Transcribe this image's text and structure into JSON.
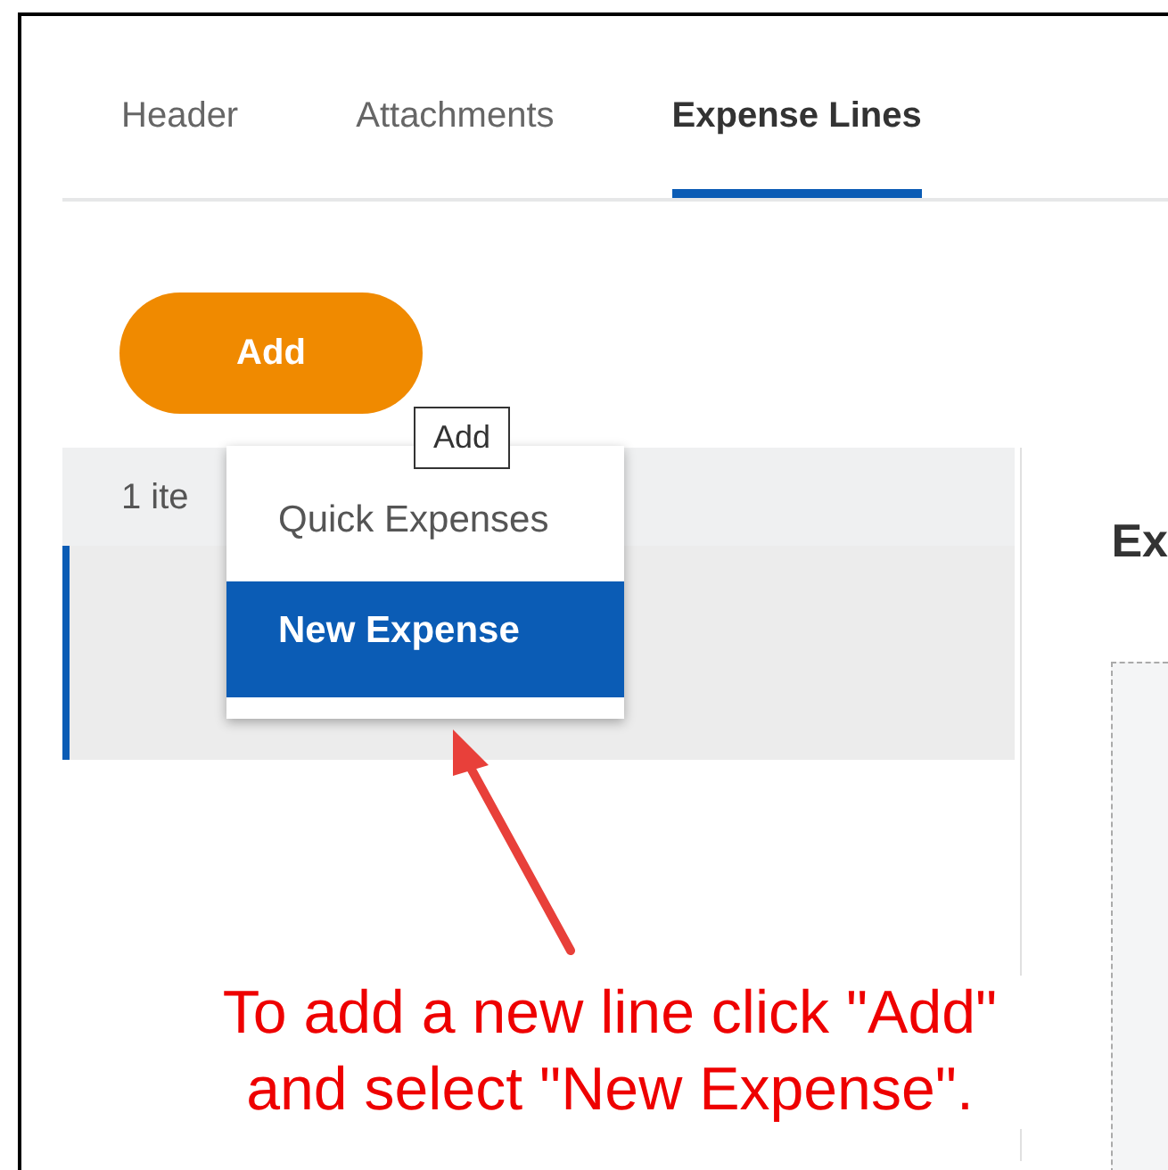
{
  "tabs": [
    {
      "label": "Header",
      "selected": false
    },
    {
      "label": "Attachments",
      "selected": false
    },
    {
      "label": "Expense Lines",
      "selected": true
    }
  ],
  "add_button": {
    "label": "Add"
  },
  "list": {
    "count": "1 ite",
    "rows": [
      {
        "selected": true
      }
    ]
  },
  "detail": {
    "heading": "Ex"
  },
  "add_menu": {
    "items": [
      {
        "label": "Quick Expenses",
        "selected": false
      },
      {
        "label": "New Expense",
        "selected": true
      }
    ]
  },
  "tooltip": "Add",
  "annotation": "To add a new line click \"Add\"\nand select \"New Expense\"."
}
